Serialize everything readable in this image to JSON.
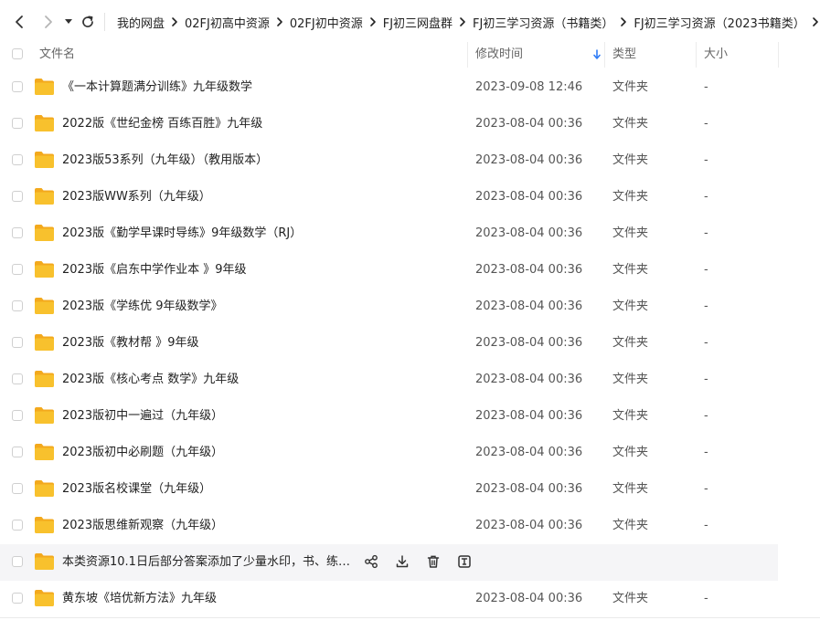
{
  "nav": {
    "back_icon": "chevron-left-icon",
    "forward_icon": "chevron-right-icon",
    "history_icon": "caret-down-icon",
    "refresh_icon": "refresh-icon"
  },
  "breadcrumb": [
    "我的网盘",
    "02FJ初高中资源",
    "02FJ初中资源",
    "FJ初三网盘群",
    "FJ初三学习资源（书籍类）",
    "FJ初三学习资源（2023书籍类）"
  ],
  "columns": {
    "name": "文件名",
    "modified": "修改时间",
    "type": "类型",
    "size": "大小",
    "sort_icon": "arrow-down-icon",
    "sort_color": "#2f7cf6"
  },
  "files": [
    {
      "name": "《一本计算题满分训练》九年级数学",
      "modified": "2023-09-08 12:46",
      "type": "文件夹",
      "size": "-"
    },
    {
      "name": "2022版《世纪金榜  百练百胜》九年级",
      "modified": "2023-08-04 00:36",
      "type": "文件夹",
      "size": "-"
    },
    {
      "name": "2023版53系列（九年级）（教用版本）",
      "modified": "2023-08-04 00:36",
      "type": "文件夹",
      "size": "-"
    },
    {
      "name": "2023版WW系列（九年级）",
      "modified": "2023-08-04 00:36",
      "type": "文件夹",
      "size": "-"
    },
    {
      "name": "2023版《勤学早课时导练》9年级数学（RJ）",
      "modified": "2023-08-04 00:36",
      "type": "文件夹",
      "size": "-"
    },
    {
      "name": "2023版《启东中学作业本 》9年级",
      "modified": "2023-08-04 00:36",
      "type": "文件夹",
      "size": "-"
    },
    {
      "name": "2023版《学练优 9年级数学》",
      "modified": "2023-08-04 00:36",
      "type": "文件夹",
      "size": "-"
    },
    {
      "name": "2023版《教材帮 》9年级",
      "modified": "2023-08-04 00:36",
      "type": "文件夹",
      "size": "-"
    },
    {
      "name": "2023版《核心考点  数学》九年级",
      "modified": "2023-08-04 00:36",
      "type": "文件夹",
      "size": "-"
    },
    {
      "name": "2023版初中一遍过（九年级）",
      "modified": "2023-08-04 00:36",
      "type": "文件夹",
      "size": "-"
    },
    {
      "name": "2023版初中必刷题（九年级）",
      "modified": "2023-08-04 00:36",
      "type": "文件夹",
      "size": "-"
    },
    {
      "name": "2023版名校课堂（九年级）",
      "modified": "2023-08-04 00:36",
      "type": "文件夹",
      "size": "-"
    },
    {
      "name": "2023版思维新观察（九年级）",
      "modified": "2023-08-04 00:36",
      "type": "文件夹",
      "size": "-"
    },
    {
      "name": "本类资源10.1日后部分答案添加了少量水印，书、练习正...",
      "modified": "",
      "type": "",
      "size": "",
      "hovered": true
    },
    {
      "name": "黄东坡《培优新方法》九年级",
      "modified": "2023-08-04 00:36",
      "type": "文件夹",
      "size": "-"
    }
  ],
  "row_actions": [
    "share-icon",
    "download-icon",
    "delete-icon",
    "rename-icon"
  ],
  "colors": {
    "folder": "#f8c12d",
    "folder_back": "#f3a91d",
    "hover_bg": "#f5f5f7"
  }
}
